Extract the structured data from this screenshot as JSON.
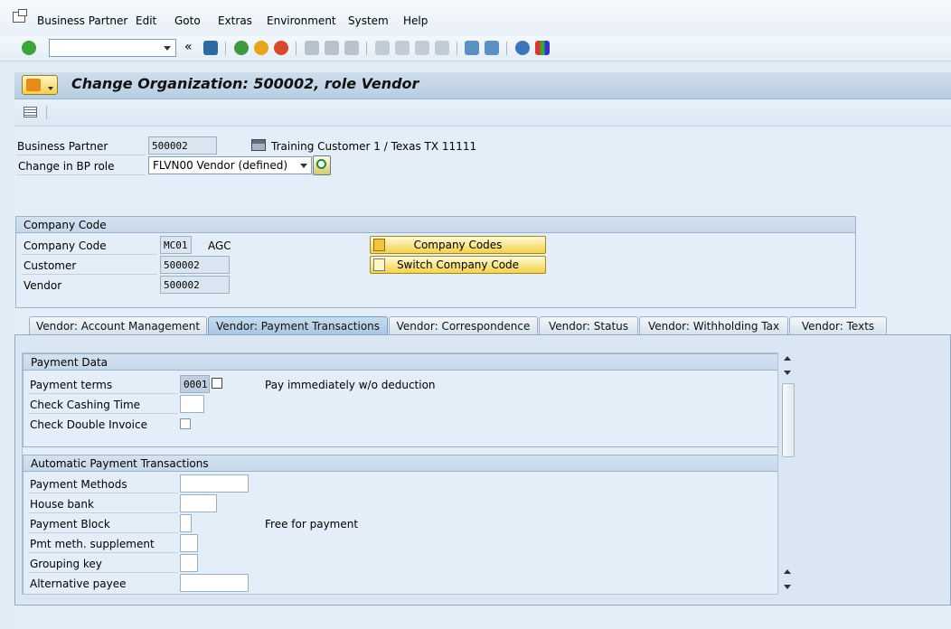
{
  "menubar": {
    "items": [
      "Business Partner",
      "Edit",
      "Goto",
      "Extras",
      "Environment",
      "System",
      "Help"
    ]
  },
  "toolbar": {
    "command_value": "",
    "icons": [
      "enter-icon",
      "back-icon",
      "exit-icon",
      "cancel-icon",
      "print-icon",
      "find-icon",
      "find-next-icon",
      "first-page-icon",
      "previous-page-icon",
      "next-page-icon",
      "last-page-icon",
      "create-session-icon",
      "generate-shortcut-icon",
      "help-icon",
      "customize-layout-icon"
    ],
    "collapse_glyph": "«"
  },
  "header": {
    "title": "Change Organization: 500002, role Vendor"
  },
  "partner": {
    "bp_label": "Business Partner",
    "bp_value": "500002",
    "bp_description": "Training Customer 1 / Texas TX 11111",
    "role_label": "Change in BP role",
    "role_value": "FLVN00 Vendor (defined)"
  },
  "company_code_group": {
    "title": "Company Code",
    "company_code_label": "Company Code",
    "company_code_value": "MC01",
    "company_code_text": "AGC",
    "customer_label": "Customer",
    "customer_value": "500002",
    "vendor_label": "Vendor",
    "vendor_value": "500002",
    "company_codes_button": "Company Codes",
    "switch_company_code_button": "Switch Company Code"
  },
  "tabs": [
    {
      "label": "Vendor: Account Management",
      "active": false
    },
    {
      "label": "Vendor: Payment Transactions",
      "active": true
    },
    {
      "label": "Vendor: Correspondence",
      "active": false
    },
    {
      "label": "Vendor: Status",
      "active": false
    },
    {
      "label": "Vendor: Withholding Tax",
      "active": false
    },
    {
      "label": "Vendor: Texts",
      "active": false
    }
  ],
  "payment_data": {
    "title": "Payment Data",
    "payment_terms_label": "Payment terms",
    "payment_terms_value": "0001",
    "payment_terms_text": "Pay immediately w/o deduction",
    "check_cashing_label": "Check Cashing Time",
    "check_cashing_value": "",
    "double_invoice_label": "Check Double Invoice",
    "double_invoice_checked": false
  },
  "auto_payment": {
    "title": "Automatic Payment Transactions",
    "payment_methods_label": "Payment Methods",
    "payment_methods_value": "",
    "house_bank_label": "House bank",
    "house_bank_value": "",
    "payment_block_label": "Payment Block",
    "payment_block_value": "",
    "payment_block_text": "Free for payment",
    "pmt_supplement_label": "Pmt meth. supplement",
    "pmt_supplement_value": "",
    "grouping_key_label": "Grouping key",
    "grouping_key_value": "",
    "alternative_payee_label": "Alternative payee",
    "alternative_payee_value": ""
  }
}
